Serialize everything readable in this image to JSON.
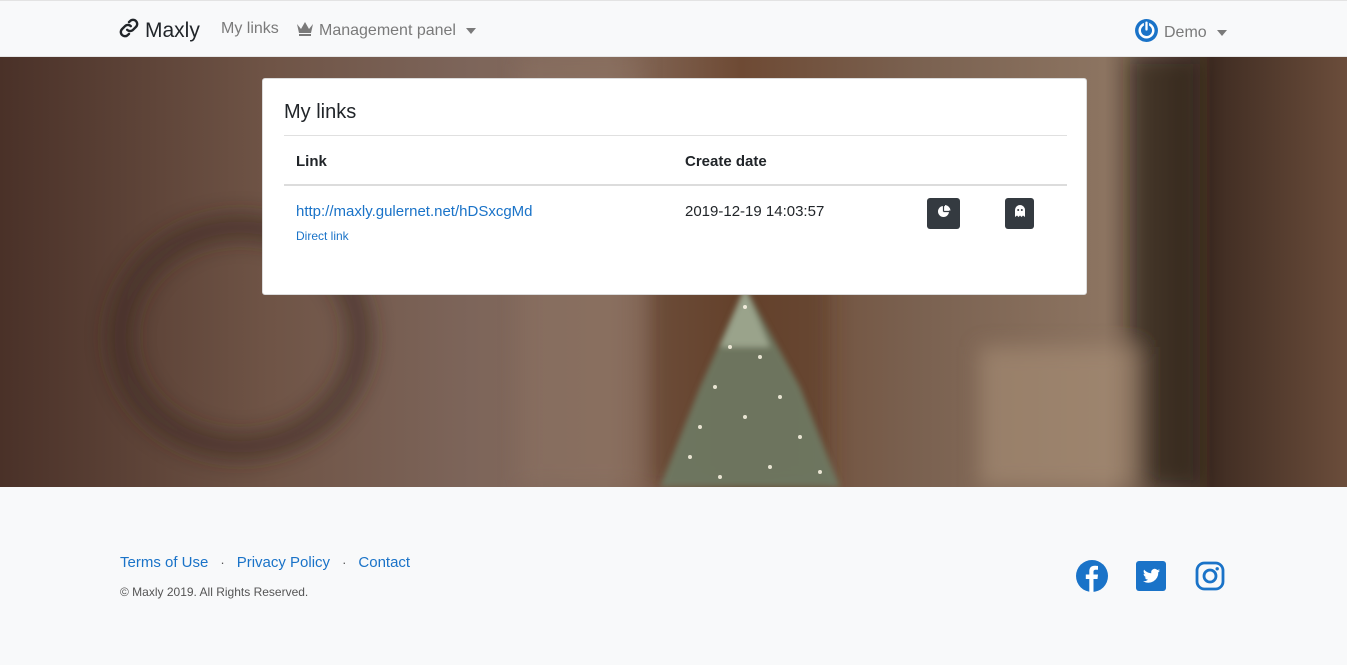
{
  "navbar": {
    "brand": "Maxly",
    "my_links": "My links",
    "management_panel": "Management panel",
    "user": "Demo"
  },
  "card": {
    "title": "My links",
    "headers": {
      "link": "Link",
      "create_date": "Create date"
    },
    "rows": [
      {
        "url": "http://maxly.gulernet.net/hDSxcgMd",
        "direct_link": "Direct link",
        "date": "2019-12-19 14:03:57"
      }
    ]
  },
  "footer": {
    "terms": "Terms of Use",
    "sep1": "·",
    "privacy": "Privacy Policy",
    "sep2": "·",
    "contact": "Contact",
    "copyright": "© Maxly 2019. All Rights Reserved."
  },
  "icons": {
    "brand": "link-icon",
    "management": "crown-icon",
    "user": "power-icon",
    "stats": "pie-chart-icon",
    "ghost": "ghost-icon",
    "facebook": "facebook-icon",
    "twitter": "twitter-icon",
    "instagram": "instagram-icon"
  },
  "colors": {
    "accent": "#1a73c8",
    "dark_button": "#343a40"
  }
}
